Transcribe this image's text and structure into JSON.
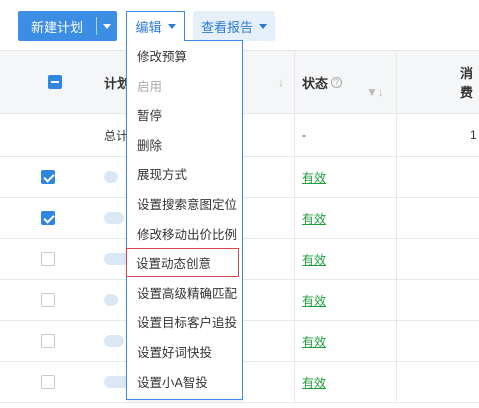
{
  "toolbar": {
    "new_plan": "新建计划",
    "edit": "编辑",
    "view_report": "查看报告"
  },
  "colors": {
    "accent": "#3c8de4",
    "status_green": "#1f9e3c",
    "highlight_red": "#d9434b"
  },
  "table": {
    "headers": {
      "plan": "计划",
      "status": "状态",
      "spend": "消费"
    },
    "help_icon_text": "?",
    "total": {
      "label": "总计",
      "status": "-",
      "spend": "1"
    },
    "rows": [
      {
        "checked": true,
        "status": "有效"
      },
      {
        "checked": true,
        "status": "有效"
      },
      {
        "checked": false,
        "status": "有效"
      },
      {
        "checked": false,
        "status": "有效"
      },
      {
        "checked": false,
        "status": "有效"
      },
      {
        "checked": false,
        "status": "有效"
      }
    ]
  },
  "edit_menu": {
    "items": [
      {
        "label": "修改预算",
        "disabled": false
      },
      {
        "label": "启用",
        "disabled": true
      },
      {
        "label": "暂停",
        "disabled": false
      },
      {
        "label": "删除",
        "disabled": false
      },
      {
        "label": "展现方式",
        "disabled": false
      },
      {
        "label": "设置搜索意图定位",
        "disabled": false
      },
      {
        "label": "修改移动出价比例",
        "disabled": false
      },
      {
        "label": "设置动态创意",
        "disabled": false,
        "highlighted": true
      },
      {
        "label": "设置高级精确匹配",
        "disabled": false
      },
      {
        "label": "设置目标客户追投",
        "disabled": false
      },
      {
        "label": "设置好词快投",
        "disabled": false
      },
      {
        "label": "设置小A智投",
        "disabled": false
      }
    ]
  }
}
